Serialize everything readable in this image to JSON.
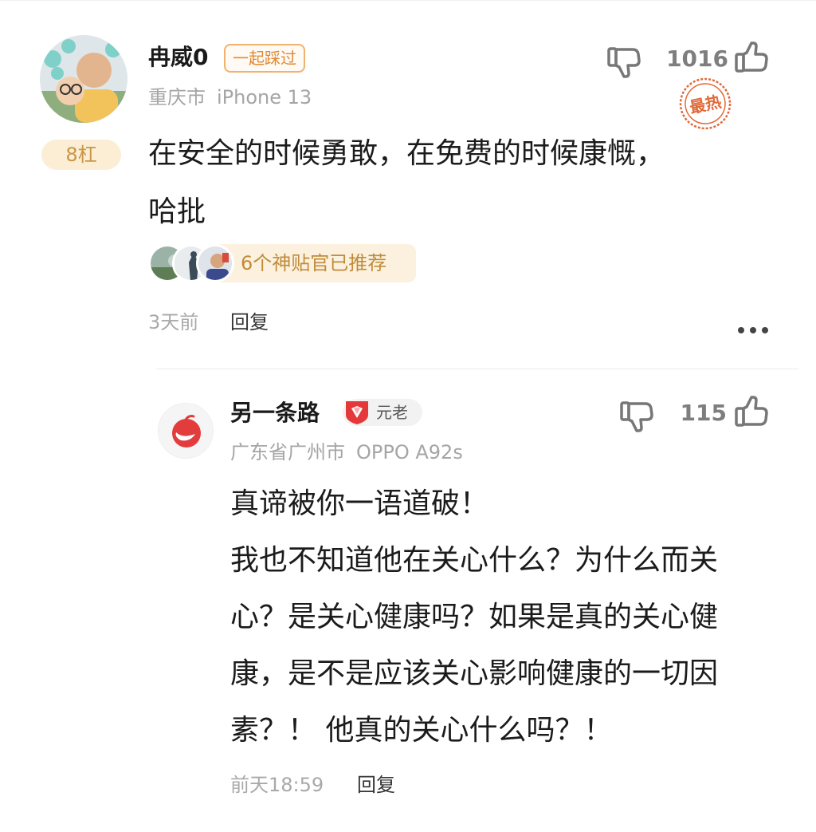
{
  "main_comment": {
    "floor": "8杠",
    "username": "冉威0",
    "tag": "一起踩过",
    "location": "重庆市",
    "device": "iPhone 13",
    "like_count": "1016",
    "hot_label": "最热",
    "content_lines": [
      "在安全的时候勇敢，在免费的时候康慨，",
      "哈批"
    ],
    "recommend_text": "6个神贴官已推荐",
    "time": "3天前",
    "reply_label": "回复"
  },
  "reply_comment": {
    "username": "另一条路",
    "level_label": "元老",
    "location": "广东省广州市",
    "device": "OPPO A92s",
    "like_count": "115",
    "content_lines": [
      "真谛被你一语道破！",
      "我也不知道他在关心什么？为什么而关",
      "心？是关心健康吗？如果是真的关心健",
      "康，是不是应该关心影响健康的一切因",
      "素？！ 他真的关心什么吗？！"
    ],
    "time": "前天18:59",
    "reply_label": "回复"
  },
  "icons": {
    "like": "thumbs-up-icon",
    "dislike": "thumbs-down-icon",
    "more": "more-dots-icon"
  },
  "colors": {
    "floor_bg": "#fbeed5",
    "floor_text": "#c99645",
    "tag_border": "#f0b26f",
    "hot_stamp": "#e06a3a",
    "recommend_bg": "#fbf1de",
    "level_red": "#e5383b"
  }
}
